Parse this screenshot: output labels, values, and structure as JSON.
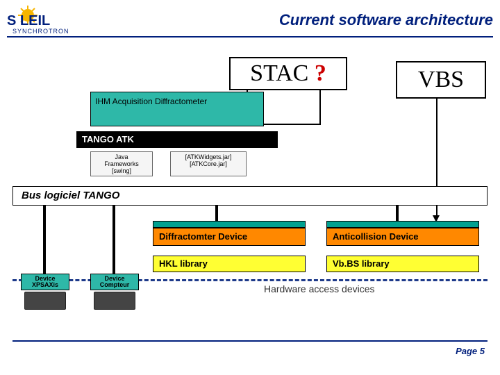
{
  "header": {
    "logo_top": "S   LEIL",
    "logo_bottom": "SYNCHROTRON",
    "title": "Current software architecture"
  },
  "boxes": {
    "stac": "STAC",
    "stac_q": "?",
    "vbs": "VBS",
    "ihm": "IHM Acquisition Diffractometer",
    "atk": "TANGO ATK",
    "fw1": "Java\nFrameworks\n[swing]",
    "fw2": "[ATKWidgets.jar]\n[ATKCore.jar]",
    "bus": "Bus logiciel TANGO",
    "dev1": "Diffractomter Device",
    "dev2": "Anticollision  Device",
    "lib1": "HKL library",
    "lib2": "Vb.BS library",
    "hw_label": "Hardware access devices",
    "mini1": "Device\nXPSAXis",
    "mini2": "Device\nCompteur"
  },
  "footer": {
    "page": "Page 5"
  }
}
